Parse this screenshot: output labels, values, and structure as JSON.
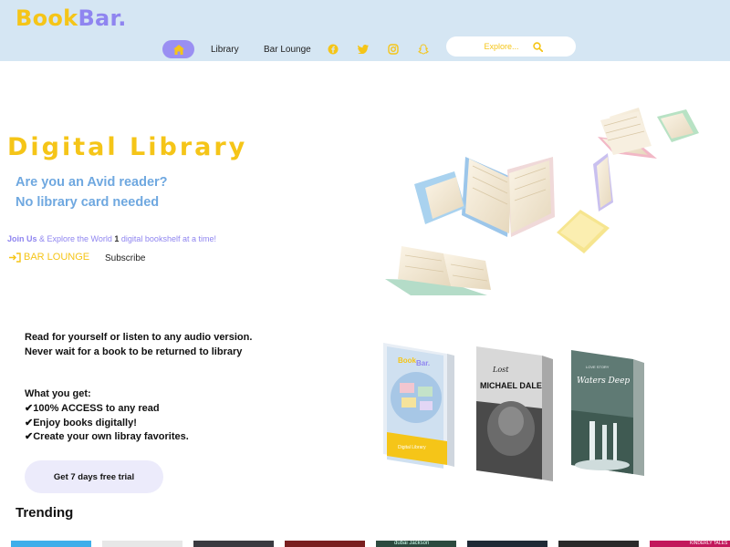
{
  "brand": {
    "part1": "Book",
    "part2": "Bar."
  },
  "nav": {
    "home_label": "Home",
    "library": "Library",
    "bar_lounge": "Bar Lounge"
  },
  "social": [
    "facebook-icon",
    "twitter-icon",
    "instagram-icon",
    "snapchat-icon"
  ],
  "search": {
    "placeholder": "Explore..."
  },
  "hero": {
    "title": "Digital Library",
    "subtitle_1": "Are you an Avid reader?",
    "subtitle_2": "No library card needed",
    "join_bold": "Join Us",
    "join_mid": " & Explore the World ",
    "join_num": "1",
    "join_end": " digital bookshelf at a time!",
    "bar_lounge_link": "BAR LOUNGE",
    "subscribe": "Subscribe"
  },
  "info": {
    "read_1": "Read for yourself or listen to any audio version.",
    "read_2": "Never wait for a book to be returned to library",
    "what_title": "What you get:",
    "benefits": [
      "✔100% ACCESS to any read",
      "✔Enjoy books digitally!",
      "✔Create your own libray favorites."
    ],
    "trial_button": "Get 7 days free trial"
  },
  "books": [
    {
      "title": "BookBar.",
      "caption": "Digital Library"
    },
    {
      "title_top": "Lost",
      "title_main": "MICHAEL DALE"
    },
    {
      "title_main": "Waters Deep",
      "title_top": "LOVE STORY"
    }
  ],
  "trending": {
    "title": "Trending",
    "strip_text": [
      "dubai Jackson",
      "KINDERLY TALES"
    ]
  },
  "colors": {
    "yellow": "#f5c518",
    "purple": "#8f85f0",
    "sky": "#6fa8e0",
    "header_bg": "#d5e6f3"
  }
}
